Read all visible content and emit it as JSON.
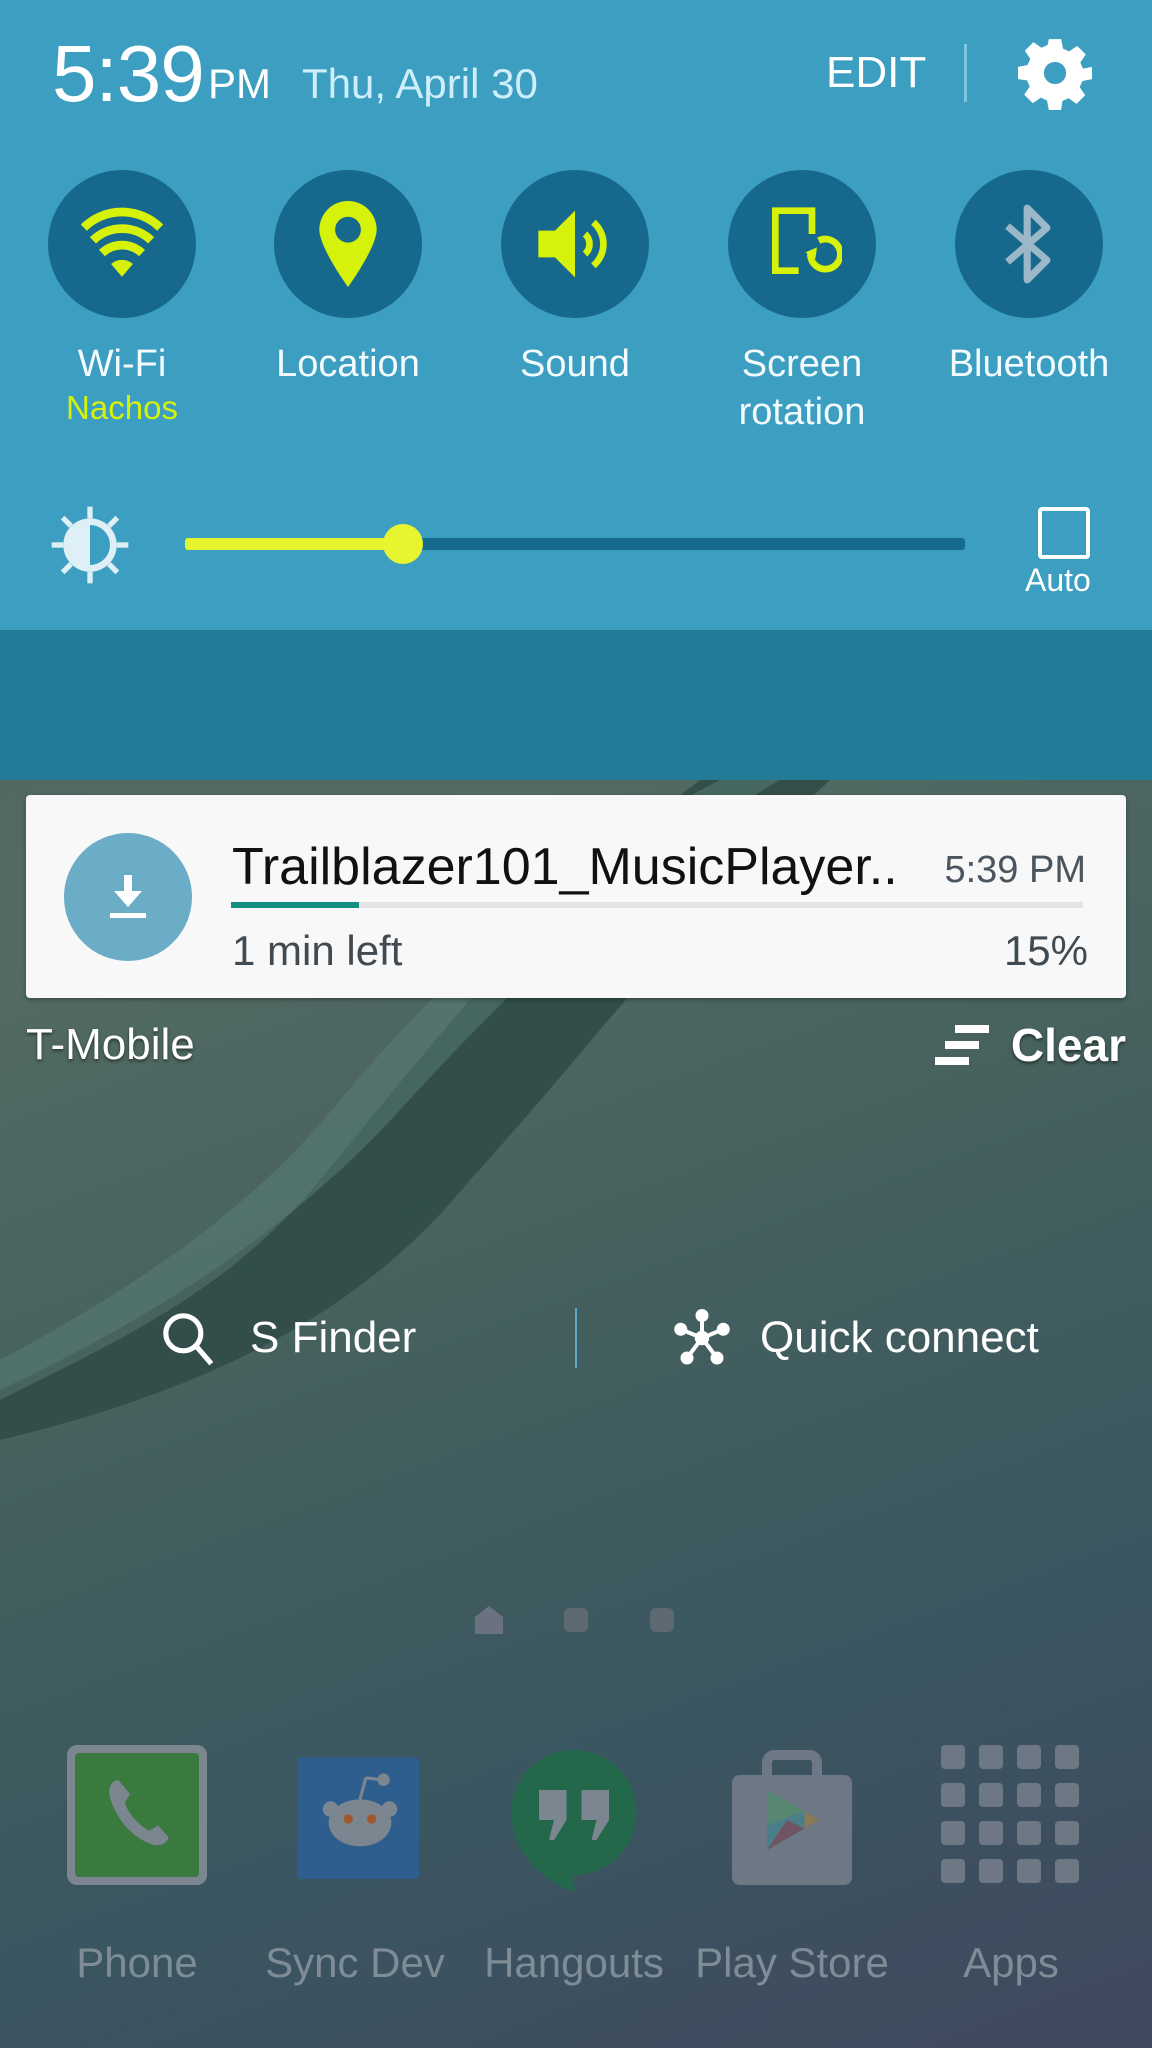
{
  "status": {
    "time": "5:39",
    "ampm": "PM",
    "date": "Thu, April 30",
    "edit_label": "EDIT",
    "settings_icon": "gear-icon"
  },
  "quick_toggles": [
    {
      "label": "Wi-Fi",
      "sublabel": "Nachos",
      "icon": "wifi-icon",
      "state": "on"
    },
    {
      "label": "Location",
      "sublabel": "",
      "icon": "location-pin-icon",
      "state": "on"
    },
    {
      "label": "Sound",
      "sublabel": "",
      "icon": "speaker-icon",
      "state": "on"
    },
    {
      "label": "Screen rotation",
      "sublabel": "",
      "icon": "screen-rotation-icon",
      "state": "on"
    },
    {
      "label": "Bluetooth",
      "sublabel": "",
      "icon": "bluetooth-icon",
      "state": "off"
    }
  ],
  "brightness": {
    "level": 0.28,
    "auto_label": "Auto",
    "auto_checked": false,
    "icon": "brightness-icon"
  },
  "shortcuts": {
    "s_finder": "S Finder",
    "quick_connect": "Quick connect"
  },
  "notification": {
    "icon": "download-icon",
    "title": "Trailblazer101_MusicPlayer..",
    "time": "5:39 PM",
    "subtext": "1 min left",
    "percent_label": "15%",
    "progress": 0.15
  },
  "carrier": "T-Mobile",
  "clear_label": "Clear",
  "home": {
    "pages": 3,
    "current_page": 0
  },
  "dock": [
    {
      "label": "Phone",
      "icon": "phone-icon"
    },
    {
      "label": "Sync Dev",
      "icon": "reddit-alien-icon"
    },
    {
      "label": "Hangouts",
      "icon": "hangouts-icon"
    },
    {
      "label": "Play Store",
      "icon": "play-store-icon"
    },
    {
      "label": "Apps",
      "icon": "apps-grid-icon"
    }
  ],
  "colors": {
    "panel": "#3c9ec0",
    "toggle_bg": "#16698c",
    "active_accent": "#d6f20a",
    "inactive_icon": "#9ab8c8",
    "shortcut_bar": "#247b98",
    "progress": "#13907f"
  }
}
